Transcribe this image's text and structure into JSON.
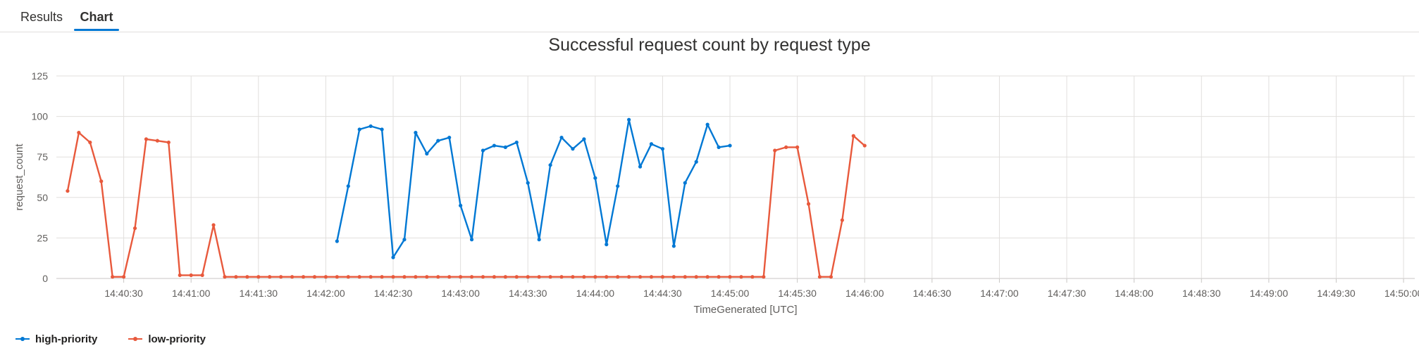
{
  "tabs": [
    {
      "label": "Results",
      "active": false
    },
    {
      "label": "Chart",
      "active": true
    }
  ],
  "colors": {
    "accent": "#0078d4",
    "grid": "#e1dfdd"
  },
  "chart_data": {
    "type": "line",
    "title": "Successful request count by request type",
    "xlabel": "TimeGenerated [UTC]",
    "ylabel": "request_count",
    "ylim": [
      0,
      125
    ],
    "yticks": [
      0,
      25,
      50,
      75,
      100,
      125
    ],
    "xlim": [
      "14:40:00",
      "14:50:05"
    ],
    "xticks": [
      "14:40:30",
      "14:41:00",
      "14:41:30",
      "14:42:00",
      "14:42:30",
      "14:43:00",
      "14:43:30",
      "14:44:00",
      "14:44:30",
      "14:45:00",
      "14:45:30",
      "14:46:00",
      "14:46:30",
      "14:47:00",
      "14:47:30",
      "14:48:00",
      "14:48:30",
      "14:49:00",
      "14:49:30",
      "14:50:00"
    ],
    "grid": true,
    "legend_position": "bottom-left",
    "series": [
      {
        "name": "high-priority",
        "color": "#0078d4",
        "points": [
          [
            "14:42:05",
            23
          ],
          [
            "14:42:10",
            57
          ],
          [
            "14:42:15",
            92
          ],
          [
            "14:42:20",
            94
          ],
          [
            "14:42:25",
            92
          ],
          [
            "14:42:30",
            13
          ],
          [
            "14:42:35",
            24
          ],
          [
            "14:42:40",
            90
          ],
          [
            "14:42:45",
            77
          ],
          [
            "14:42:50",
            85
          ],
          [
            "14:42:55",
            87
          ],
          [
            "14:43:00",
            45
          ],
          [
            "14:43:05",
            24
          ],
          [
            "14:43:10",
            79
          ],
          [
            "14:43:15",
            82
          ],
          [
            "14:43:20",
            81
          ],
          [
            "14:43:25",
            84
          ],
          [
            "14:43:30",
            59
          ],
          [
            "14:43:35",
            24
          ],
          [
            "14:43:40",
            70
          ],
          [
            "14:43:45",
            87
          ],
          [
            "14:43:50",
            80
          ],
          [
            "14:43:55",
            86
          ],
          [
            "14:44:00",
            62
          ],
          [
            "14:44:05",
            21
          ],
          [
            "14:44:10",
            57
          ],
          [
            "14:44:15",
            98
          ],
          [
            "14:44:20",
            69
          ],
          [
            "14:44:25",
            83
          ],
          [
            "14:44:30",
            80
          ],
          [
            "14:44:35",
            20
          ],
          [
            "14:44:40",
            59
          ],
          [
            "14:44:45",
            72
          ],
          [
            "14:44:50",
            95
          ],
          [
            "14:44:55",
            81
          ],
          [
            "14:45:00",
            82
          ]
        ]
      },
      {
        "name": "low-priority",
        "color": "#e8593c",
        "points": [
          [
            "14:40:05",
            54
          ],
          [
            "14:40:10",
            90
          ],
          [
            "14:40:15",
            84
          ],
          [
            "14:40:20",
            60
          ],
          [
            "14:40:25",
            1
          ],
          [
            "14:40:30",
            1
          ],
          [
            "14:40:35",
            31
          ],
          [
            "14:40:40",
            86
          ],
          [
            "14:40:45",
            85
          ],
          [
            "14:40:50",
            84
          ],
          [
            "14:40:55",
            2
          ],
          [
            "14:41:00",
            2
          ],
          [
            "14:41:05",
            2
          ],
          [
            "14:41:10",
            33
          ],
          [
            "14:41:15",
            1
          ],
          [
            "14:41:20",
            1
          ],
          [
            "14:41:25",
            1
          ],
          [
            "14:41:30",
            1
          ],
          [
            "14:41:35",
            1
          ],
          [
            "14:41:40",
            1
          ],
          [
            "14:41:45",
            1
          ],
          [
            "14:41:50",
            1
          ],
          [
            "14:41:55",
            1
          ],
          [
            "14:42:00",
            1
          ],
          [
            "14:42:05",
            1
          ],
          [
            "14:42:10",
            1
          ],
          [
            "14:42:15",
            1
          ],
          [
            "14:42:20",
            1
          ],
          [
            "14:42:25",
            1
          ],
          [
            "14:42:30",
            1
          ],
          [
            "14:42:35",
            1
          ],
          [
            "14:42:40",
            1
          ],
          [
            "14:42:45",
            1
          ],
          [
            "14:42:50",
            1
          ],
          [
            "14:42:55",
            1
          ],
          [
            "14:43:00",
            1
          ],
          [
            "14:43:05",
            1
          ],
          [
            "14:43:10",
            1
          ],
          [
            "14:43:15",
            1
          ],
          [
            "14:43:20",
            1
          ],
          [
            "14:43:25",
            1
          ],
          [
            "14:43:30",
            1
          ],
          [
            "14:43:35",
            1
          ],
          [
            "14:43:40",
            1
          ],
          [
            "14:43:45",
            1
          ],
          [
            "14:43:50",
            1
          ],
          [
            "14:43:55",
            1
          ],
          [
            "14:44:00",
            1
          ],
          [
            "14:44:05",
            1
          ],
          [
            "14:44:10",
            1
          ],
          [
            "14:44:15",
            1
          ],
          [
            "14:44:20",
            1
          ],
          [
            "14:44:25",
            1
          ],
          [
            "14:44:30",
            1
          ],
          [
            "14:44:35",
            1
          ],
          [
            "14:44:40",
            1
          ],
          [
            "14:44:45",
            1
          ],
          [
            "14:44:50",
            1
          ],
          [
            "14:44:55",
            1
          ],
          [
            "14:45:00",
            1
          ],
          [
            "14:45:05",
            1
          ],
          [
            "14:45:10",
            1
          ],
          [
            "14:45:15",
            1
          ],
          [
            "14:45:20",
            79
          ],
          [
            "14:45:25",
            81
          ],
          [
            "14:45:30",
            81
          ],
          [
            "14:45:35",
            46
          ],
          [
            "14:45:40",
            1
          ],
          [
            "14:45:45",
            1
          ],
          [
            "14:45:50",
            36
          ],
          [
            "14:45:55",
            88
          ],
          [
            "14:46:00",
            82
          ]
        ]
      }
    ]
  }
}
